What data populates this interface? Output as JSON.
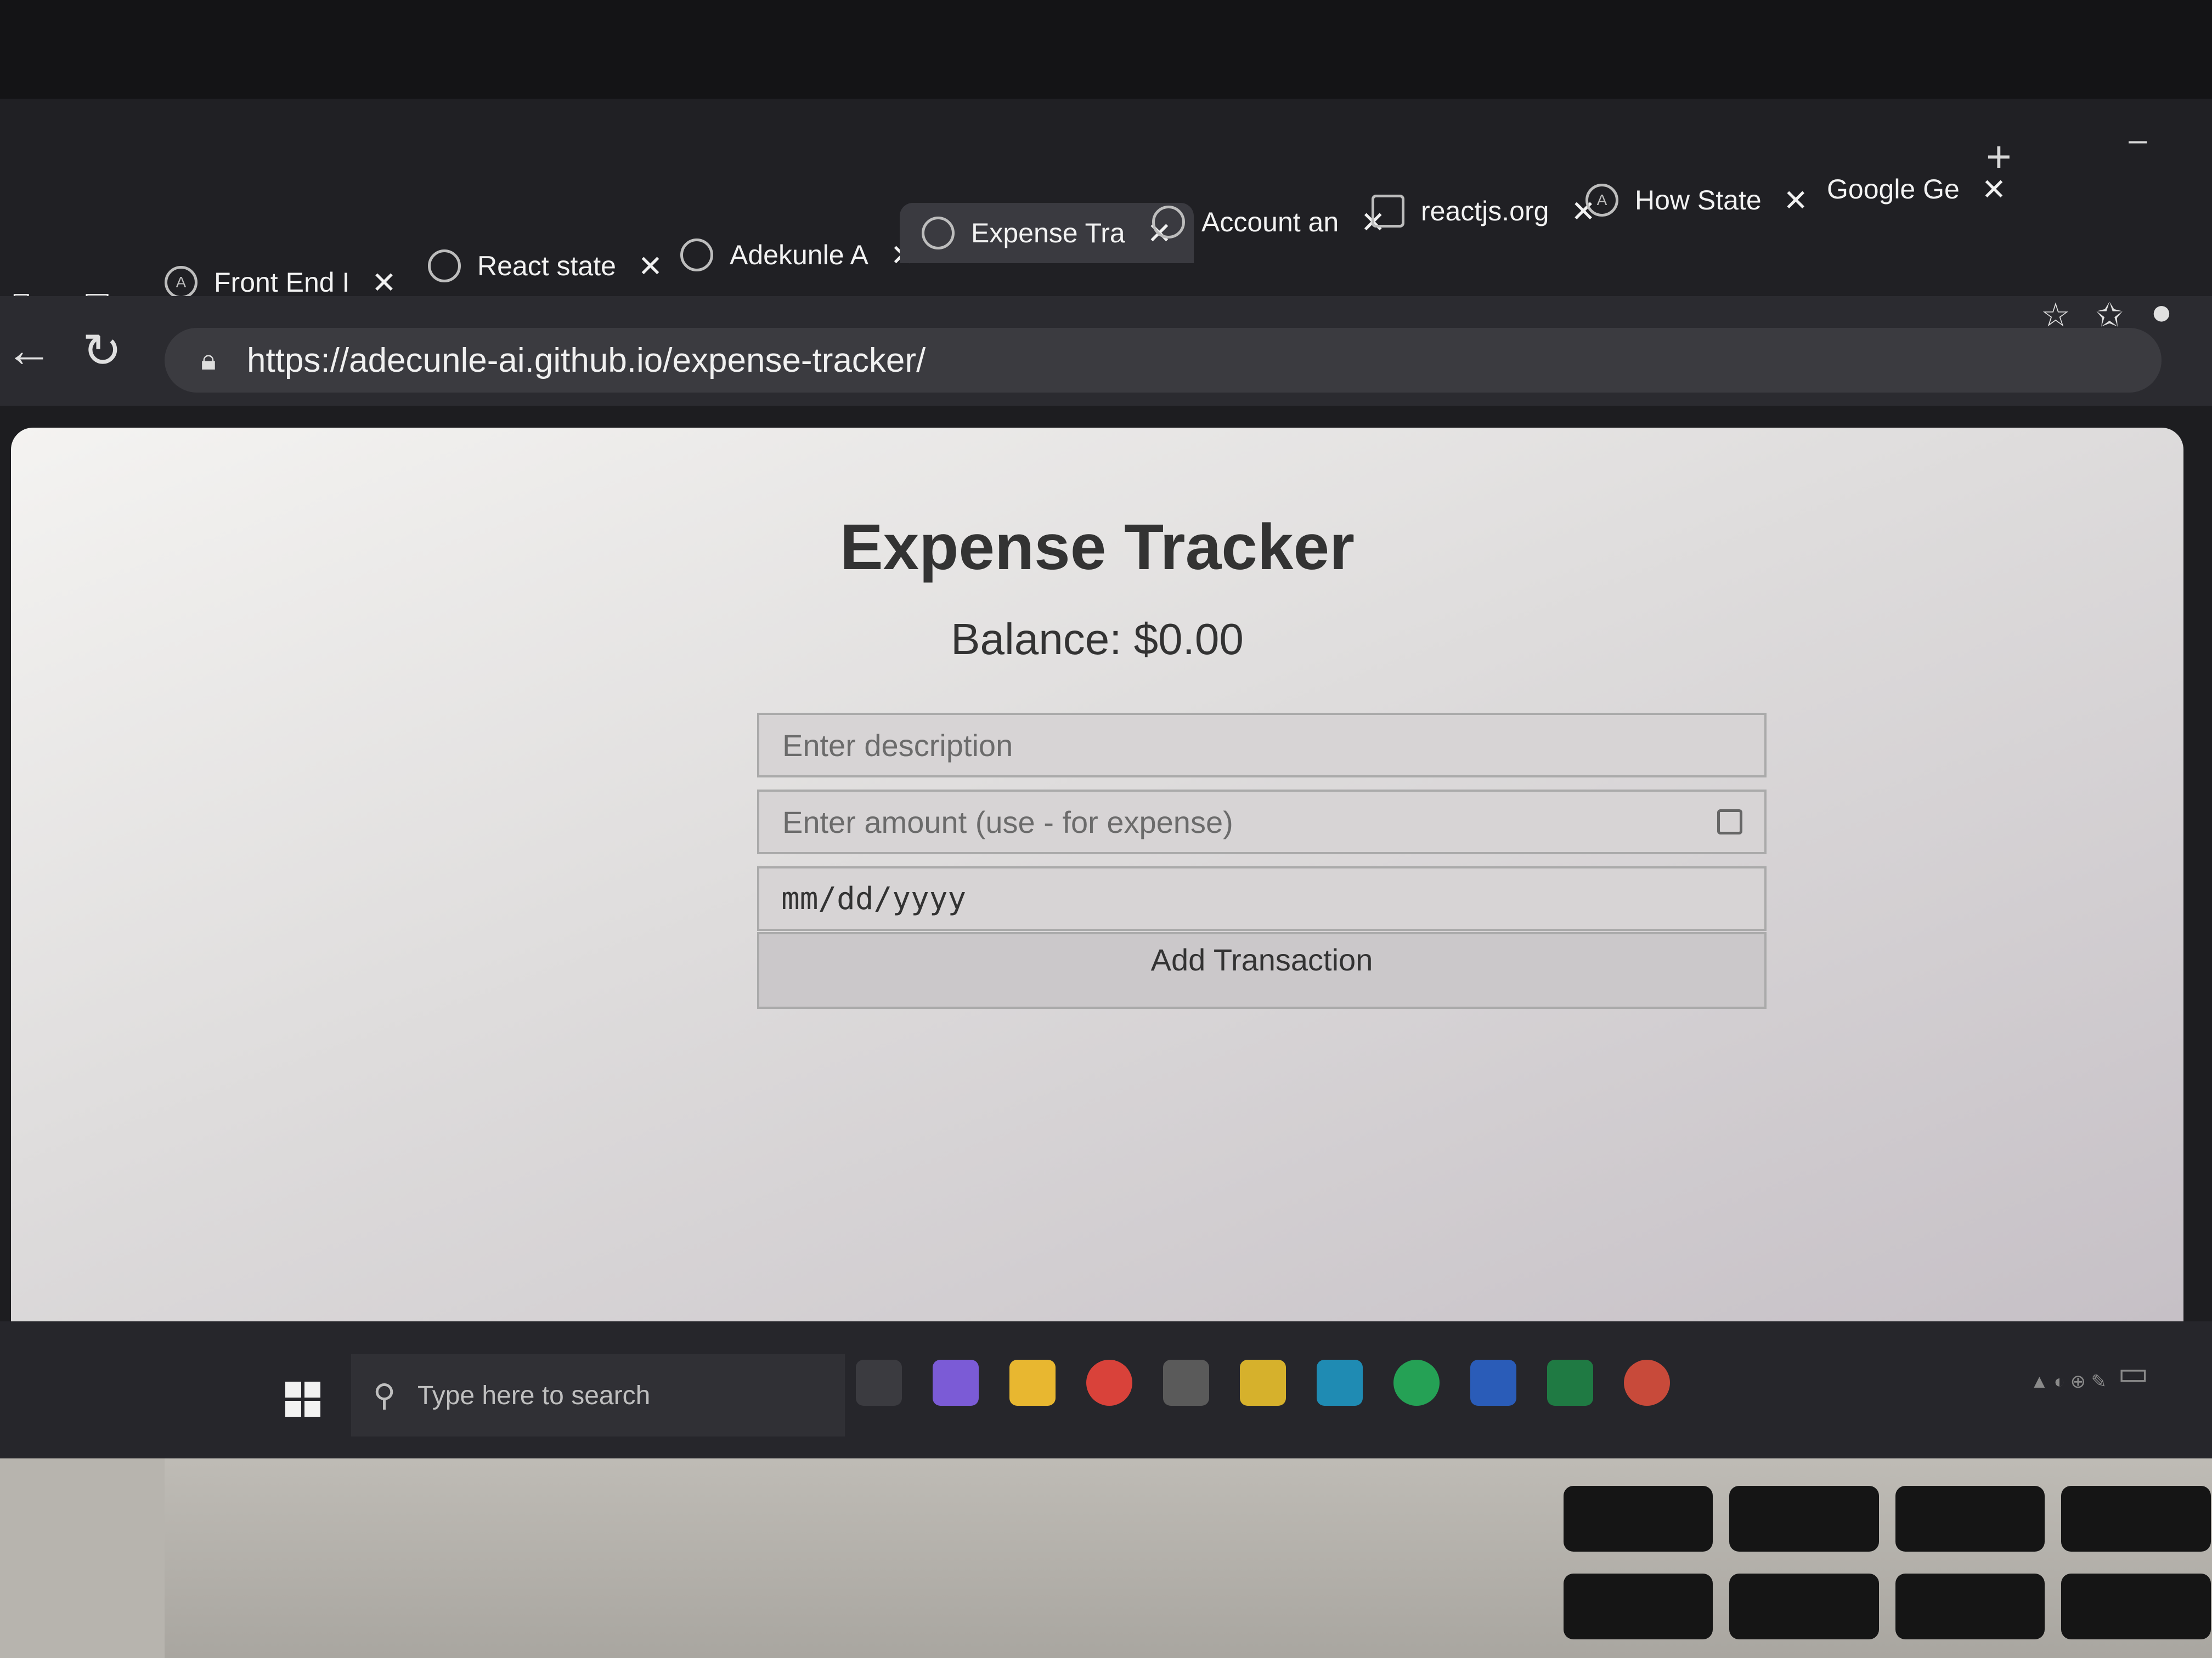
{
  "browser": {
    "tabs": [
      {
        "label": "Front End I",
        "favicon": "A",
        "active": false
      },
      {
        "label": "React state",
        "favicon": "openai-icon",
        "active": false
      },
      {
        "label": "Adekunle A",
        "favicon": "globe-icon",
        "active": false
      },
      {
        "label": "Expense Tra",
        "favicon": "globe-icon",
        "active": true
      },
      {
        "label": "Account an",
        "favicon": "github-icon",
        "active": false
      },
      {
        "label": "reactjs.org",
        "favicon": "document-icon",
        "active": false
      },
      {
        "label": "How State",
        "favicon": "A",
        "active": false
      },
      {
        "label": "Google Ge",
        "favicon": "",
        "active": false
      }
    ],
    "close_glyph": "✕",
    "new_tab_glyph": "+",
    "address": "https://adecunle-ai.github.io/expense-tracker/"
  },
  "app": {
    "title": "Expense Tracker",
    "balance": "Balance: $0.00",
    "description_placeholder": "Enter description",
    "amount_placeholder": "Enter amount (use - for expense)",
    "date_placeholder": "mm/dd/yyyy",
    "add_button": "Add Transaction"
  },
  "taskbar": {
    "search_placeholder": "Type here to search"
  }
}
